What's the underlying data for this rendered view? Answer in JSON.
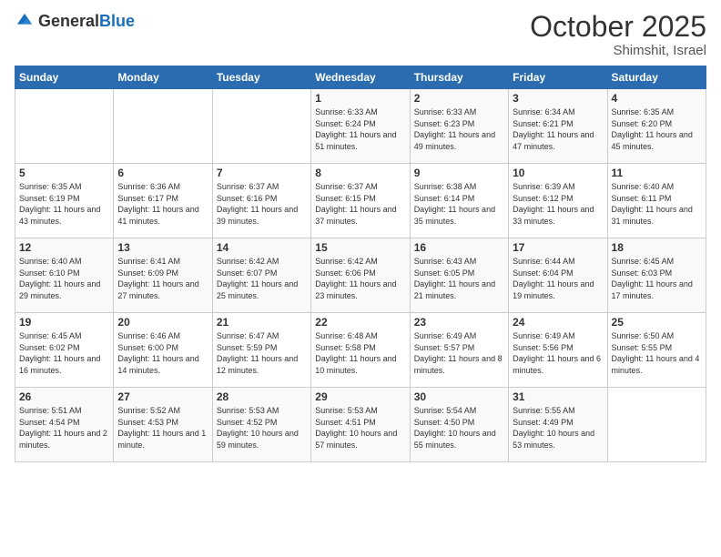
{
  "header": {
    "logo_general": "General",
    "logo_blue": "Blue",
    "month_year": "October 2025",
    "location": "Shimshit, Israel"
  },
  "weekdays": [
    "Sunday",
    "Monday",
    "Tuesday",
    "Wednesday",
    "Thursday",
    "Friday",
    "Saturday"
  ],
  "weeks": [
    [
      {
        "day": "",
        "info": ""
      },
      {
        "day": "",
        "info": ""
      },
      {
        "day": "",
        "info": ""
      },
      {
        "day": "1",
        "info": "Sunrise: 6:33 AM\nSunset: 6:24 PM\nDaylight: 11 hours\nand 51 minutes."
      },
      {
        "day": "2",
        "info": "Sunrise: 6:33 AM\nSunset: 6:23 PM\nDaylight: 11 hours\nand 49 minutes."
      },
      {
        "day": "3",
        "info": "Sunrise: 6:34 AM\nSunset: 6:21 PM\nDaylight: 11 hours\nand 47 minutes."
      },
      {
        "day": "4",
        "info": "Sunrise: 6:35 AM\nSunset: 6:20 PM\nDaylight: 11 hours\nand 45 minutes."
      }
    ],
    [
      {
        "day": "5",
        "info": "Sunrise: 6:35 AM\nSunset: 6:19 PM\nDaylight: 11 hours\nand 43 minutes."
      },
      {
        "day": "6",
        "info": "Sunrise: 6:36 AM\nSunset: 6:17 PM\nDaylight: 11 hours\nand 41 minutes."
      },
      {
        "day": "7",
        "info": "Sunrise: 6:37 AM\nSunset: 6:16 PM\nDaylight: 11 hours\nand 39 minutes."
      },
      {
        "day": "8",
        "info": "Sunrise: 6:37 AM\nSunset: 6:15 PM\nDaylight: 11 hours\nand 37 minutes."
      },
      {
        "day": "9",
        "info": "Sunrise: 6:38 AM\nSunset: 6:14 PM\nDaylight: 11 hours\nand 35 minutes."
      },
      {
        "day": "10",
        "info": "Sunrise: 6:39 AM\nSunset: 6:12 PM\nDaylight: 11 hours\nand 33 minutes."
      },
      {
        "day": "11",
        "info": "Sunrise: 6:40 AM\nSunset: 6:11 PM\nDaylight: 11 hours\nand 31 minutes."
      }
    ],
    [
      {
        "day": "12",
        "info": "Sunrise: 6:40 AM\nSunset: 6:10 PM\nDaylight: 11 hours\nand 29 minutes."
      },
      {
        "day": "13",
        "info": "Sunrise: 6:41 AM\nSunset: 6:09 PM\nDaylight: 11 hours\nand 27 minutes."
      },
      {
        "day": "14",
        "info": "Sunrise: 6:42 AM\nSunset: 6:07 PM\nDaylight: 11 hours\nand 25 minutes."
      },
      {
        "day": "15",
        "info": "Sunrise: 6:42 AM\nSunset: 6:06 PM\nDaylight: 11 hours\nand 23 minutes."
      },
      {
        "day": "16",
        "info": "Sunrise: 6:43 AM\nSunset: 6:05 PM\nDaylight: 11 hours\nand 21 minutes."
      },
      {
        "day": "17",
        "info": "Sunrise: 6:44 AM\nSunset: 6:04 PM\nDaylight: 11 hours\nand 19 minutes."
      },
      {
        "day": "18",
        "info": "Sunrise: 6:45 AM\nSunset: 6:03 PM\nDaylight: 11 hours\nand 17 minutes."
      }
    ],
    [
      {
        "day": "19",
        "info": "Sunrise: 6:45 AM\nSunset: 6:02 PM\nDaylight: 11 hours\nand 16 minutes."
      },
      {
        "day": "20",
        "info": "Sunrise: 6:46 AM\nSunset: 6:00 PM\nDaylight: 11 hours\nand 14 minutes."
      },
      {
        "day": "21",
        "info": "Sunrise: 6:47 AM\nSunset: 5:59 PM\nDaylight: 11 hours\nand 12 minutes."
      },
      {
        "day": "22",
        "info": "Sunrise: 6:48 AM\nSunset: 5:58 PM\nDaylight: 11 hours\nand 10 minutes."
      },
      {
        "day": "23",
        "info": "Sunrise: 6:49 AM\nSunset: 5:57 PM\nDaylight: 11 hours\nand 8 minutes."
      },
      {
        "day": "24",
        "info": "Sunrise: 6:49 AM\nSunset: 5:56 PM\nDaylight: 11 hours\nand 6 minutes."
      },
      {
        "day": "25",
        "info": "Sunrise: 6:50 AM\nSunset: 5:55 PM\nDaylight: 11 hours\nand 4 minutes."
      }
    ],
    [
      {
        "day": "26",
        "info": "Sunrise: 5:51 AM\nSunset: 4:54 PM\nDaylight: 11 hours\nand 2 minutes."
      },
      {
        "day": "27",
        "info": "Sunrise: 5:52 AM\nSunset: 4:53 PM\nDaylight: 11 hours\nand 1 minute."
      },
      {
        "day": "28",
        "info": "Sunrise: 5:53 AM\nSunset: 4:52 PM\nDaylight: 10 hours\nand 59 minutes."
      },
      {
        "day": "29",
        "info": "Sunrise: 5:53 AM\nSunset: 4:51 PM\nDaylight: 10 hours\nand 57 minutes."
      },
      {
        "day": "30",
        "info": "Sunrise: 5:54 AM\nSunset: 4:50 PM\nDaylight: 10 hours\nand 55 minutes."
      },
      {
        "day": "31",
        "info": "Sunrise: 5:55 AM\nSunset: 4:49 PM\nDaylight: 10 hours\nand 53 minutes."
      },
      {
        "day": "",
        "info": ""
      }
    ]
  ]
}
